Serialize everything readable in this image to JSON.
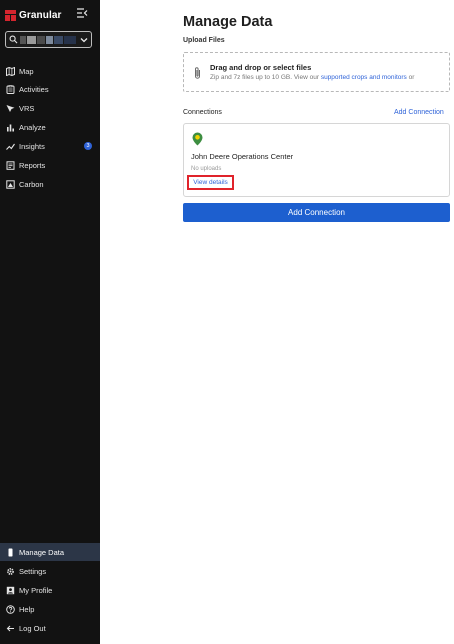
{
  "app": {
    "brand_name": "Granular",
    "colors": {
      "sidebar_bg": "#121212",
      "accent": "#1d5fcf",
      "link": "#2f63d8",
      "brand_red": "#d4252e",
      "highlight": "#e0232b"
    }
  },
  "sidebar": {
    "farm_selector": {
      "value": "",
      "icon": "search-icon"
    },
    "items": [
      {
        "label": "Map",
        "icon": "map-icon"
      },
      {
        "label": "Activities",
        "icon": "clipboard-icon"
      },
      {
        "label": "VRS",
        "icon": "vrs-icon"
      },
      {
        "label": "Analyze",
        "icon": "bar-chart-icon"
      },
      {
        "label": "Insights",
        "icon": "trend-icon",
        "badge": "3"
      },
      {
        "label": "Reports",
        "icon": "report-icon"
      },
      {
        "label": "Carbon",
        "icon": "carbon-icon"
      }
    ],
    "bottom_items": [
      {
        "label": "Manage Data",
        "icon": "phone-icon",
        "active": true
      },
      {
        "label": "Settings",
        "icon": "gear-icon"
      },
      {
        "label": "My Profile",
        "icon": "profile-icon"
      },
      {
        "label": "Help",
        "icon": "help-icon"
      },
      {
        "label": "Log Out",
        "icon": "logout-icon"
      }
    ]
  },
  "main": {
    "title": "Manage Data",
    "upload": {
      "label": "Upload Files",
      "title": "Drag and drop or select files",
      "subtitle_prefix": "Zip and 7z files up to 10 GB. View our ",
      "subtitle_link": "supported crops and monitors",
      "subtitle_suffix": " or"
    },
    "connections": {
      "label": "Connections",
      "add_link": "Add Connection",
      "items": [
        {
          "name": "John Deere Operations Center",
          "status": "No uploads",
          "action": "View details"
        }
      ],
      "add_button": "Add Connection"
    }
  }
}
